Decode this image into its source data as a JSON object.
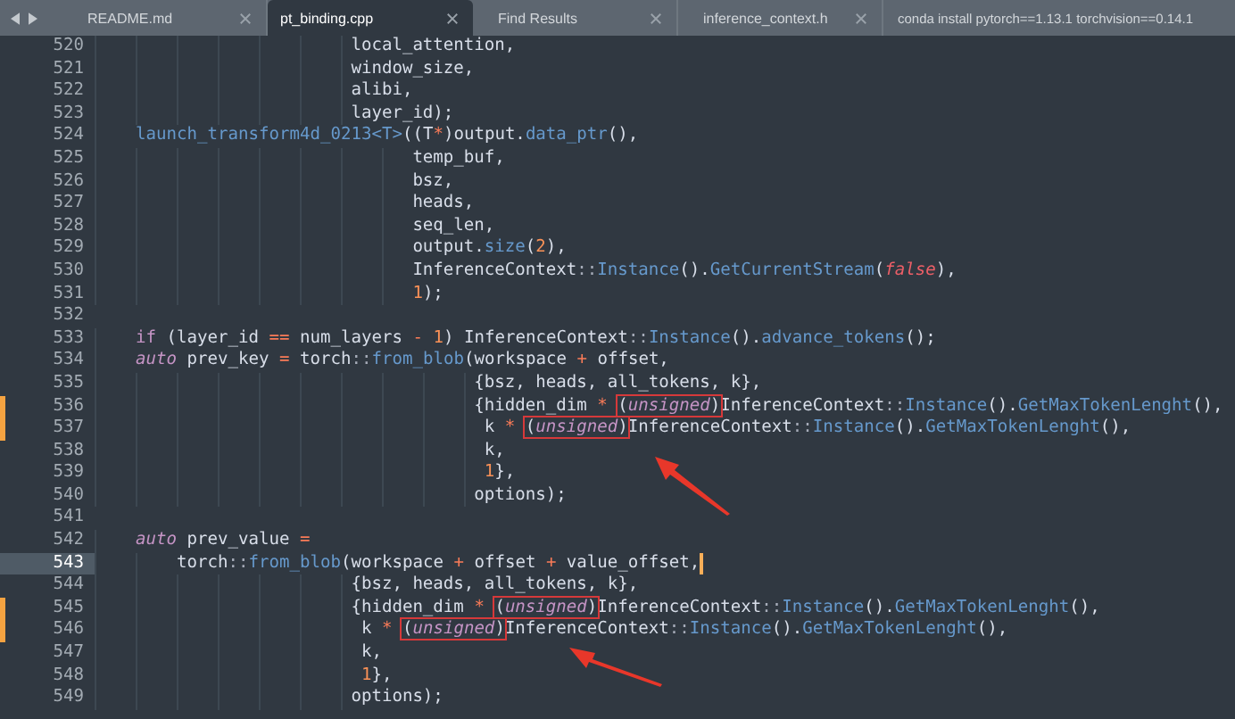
{
  "tabs": [
    {
      "label": "README.md",
      "selected": false,
      "close": true
    },
    {
      "label": "pt_binding.cpp",
      "selected": true,
      "close": true
    },
    {
      "label": "Find Results",
      "selected": false,
      "close": true
    },
    {
      "label": "inference_context.h",
      "selected": false,
      "close": true
    },
    {
      "label": "conda install pytorch==1.13.1 torchvision==0.14.1",
      "selected": false,
      "close": false
    }
  ],
  "editor": {
    "lines": [
      {
        "number": "520",
        "tokens": [
          {
            "text": "                         local_attention,",
            "kind": "plain"
          }
        ]
      },
      {
        "number": "521",
        "tokens": [
          {
            "text": "                         window_size,",
            "kind": "plain"
          }
        ]
      },
      {
        "number": "522",
        "tokens": [
          {
            "text": "                         alibi,",
            "kind": "plain"
          }
        ]
      },
      {
        "number": "523",
        "tokens": [
          {
            "text": "                         layer_id);",
            "kind": "plain"
          }
        ]
      },
      {
        "number": "524",
        "tokens": [
          {
            "text": "    launch_transform4d_0213<T>",
            "kind": "function"
          },
          {
            "text": "((T",
            "kind": "plain"
          },
          {
            "text": "*",
            "kind": "operator"
          },
          {
            "text": ")output.",
            "kind": "plain"
          },
          {
            "text": "data_ptr",
            "kind": "function"
          },
          {
            "text": "(),",
            "kind": "plain"
          }
        ]
      },
      {
        "number": "525",
        "tokens": [
          {
            "text": "                               temp_buf,",
            "kind": "plain"
          }
        ]
      },
      {
        "number": "526",
        "tokens": [
          {
            "text": "                               bsz,",
            "kind": "plain"
          }
        ]
      },
      {
        "number": "527",
        "tokens": [
          {
            "text": "                               heads,",
            "kind": "plain"
          }
        ]
      },
      {
        "number": "528",
        "tokens": [
          {
            "text": "                               seq_len,",
            "kind": "plain"
          }
        ]
      },
      {
        "number": "529",
        "tokens": [
          {
            "text": "                               output.",
            "kind": "plain"
          },
          {
            "text": "size",
            "kind": "function"
          },
          {
            "text": "(",
            "kind": "plain"
          },
          {
            "text": "2",
            "kind": "number"
          },
          {
            "text": "),",
            "kind": "plain"
          }
        ]
      },
      {
        "number": "530",
        "tokens": [
          {
            "text": "                               InferenceContext",
            "kind": "plain"
          },
          {
            "text": "::",
            "kind": "scope"
          },
          {
            "text": "Instance",
            "kind": "function"
          },
          {
            "text": "().",
            "kind": "plain"
          },
          {
            "text": "GetCurrentStream",
            "kind": "function"
          },
          {
            "text": "(",
            "kind": "plain"
          },
          {
            "text": "false",
            "kind": "constant"
          },
          {
            "text": "),",
            "kind": "plain"
          }
        ]
      },
      {
        "number": "531",
        "tokens": [
          {
            "text": "                               1",
            "kind": "number"
          },
          {
            "text": ");",
            "kind": "plain"
          }
        ]
      },
      {
        "number": "532"
      },
      {
        "number": "533",
        "tokens": [
          {
            "text": "    if",
            "kind": "keyword"
          },
          {
            "text": " (layer_id ",
            "kind": "plain"
          },
          {
            "text": "==",
            "kind": "operator"
          },
          {
            "text": " num_layers ",
            "kind": "plain"
          },
          {
            "text": "- ",
            "kind": "operator"
          },
          {
            "text": "1",
            "kind": "number"
          },
          {
            "text": ") InferenceContext",
            "kind": "plain"
          },
          {
            "text": "::",
            "kind": "scope"
          },
          {
            "text": "Instance",
            "kind": "function"
          },
          {
            "text": "().",
            "kind": "plain"
          },
          {
            "text": "advance_tokens",
            "kind": "function"
          },
          {
            "text": "();",
            "kind": "plain"
          }
        ]
      },
      {
        "number": "534",
        "tokens": [
          {
            "text": "    auto",
            "kind": "type"
          },
          {
            "text": " prev_key ",
            "kind": "plain"
          },
          {
            "text": "=",
            "kind": "operator"
          },
          {
            "text": " torch",
            "kind": "plain"
          },
          {
            "text": "::",
            "kind": "scope"
          },
          {
            "text": "from_blob",
            "kind": "function"
          },
          {
            "text": "(workspace ",
            "kind": "plain"
          },
          {
            "text": "+",
            "kind": "operator"
          },
          {
            "text": " offset,",
            "kind": "plain"
          }
        ]
      },
      {
        "number": "535",
        "tokens": [
          {
            "text": "                                     {bsz, heads, all_tokens, k},",
            "kind": "plain"
          }
        ]
      },
      {
        "number": "536",
        "modified": true,
        "tokens": [
          {
            "text": "                                     {hidden_dim ",
            "kind": "plain"
          },
          {
            "text": "* ",
            "kind": "operator"
          },
          {
            "kind": "box",
            "parts": [
              {
                "text": "(",
                "kind": "plain"
              },
              {
                "text": "unsigned",
                "kind": "type"
              },
              {
                "text": ")",
                "kind": "plain"
              }
            ]
          },
          {
            "text": "InferenceContext",
            "kind": "plain"
          },
          {
            "text": "::",
            "kind": "scope"
          },
          {
            "text": "Instance",
            "kind": "function"
          },
          {
            "text": "().",
            "kind": "plain"
          },
          {
            "text": "GetMaxTokenLenght",
            "kind": "function"
          },
          {
            "text": "(),",
            "kind": "plain"
          }
        ]
      },
      {
        "number": "537",
        "modified": true,
        "tokens": [
          {
            "text": "                                      k ",
            "kind": "plain"
          },
          {
            "text": "* ",
            "kind": "operator"
          },
          {
            "kind": "box",
            "parts": [
              {
                "text": "(",
                "kind": "plain"
              },
              {
                "text": "unsigned",
                "kind": "type"
              },
              {
                "text": ")",
                "kind": "plain"
              }
            ]
          },
          {
            "text": "InferenceContext",
            "kind": "plain"
          },
          {
            "text": "::",
            "kind": "scope"
          },
          {
            "text": "Instance",
            "kind": "function"
          },
          {
            "text": "().",
            "kind": "plain"
          },
          {
            "text": "GetMaxTokenLenght",
            "kind": "function"
          },
          {
            "text": "(),",
            "kind": "plain"
          }
        ]
      },
      {
        "number": "538",
        "arrow": true,
        "tokens": [
          {
            "text": "                                      k,",
            "kind": "plain"
          }
        ]
      },
      {
        "number": "539",
        "tokens": [
          {
            "text": "                                      1",
            "kind": "number"
          },
          {
            "text": "},",
            "kind": "plain"
          }
        ]
      },
      {
        "number": "540",
        "tokens": [
          {
            "text": "                                     options);",
            "kind": "plain"
          }
        ]
      },
      {
        "number": "541"
      },
      {
        "number": "542",
        "tokens": [
          {
            "text": "    auto",
            "kind": "type"
          },
          {
            "text": " prev_value ",
            "kind": "plain"
          },
          {
            "text": "=",
            "kind": "operator"
          }
        ]
      },
      {
        "number": "543",
        "current": true,
        "cursor": true,
        "tokens": [
          {
            "text": "        torch",
            "kind": "plain"
          },
          {
            "text": "::",
            "kind": "scope"
          },
          {
            "text": "from_blob",
            "kind": "function"
          },
          {
            "text": "(workspace ",
            "kind": "plain"
          },
          {
            "text": "+",
            "kind": "operator"
          },
          {
            "text": " offset ",
            "kind": "plain"
          },
          {
            "text": "+",
            "kind": "operator"
          },
          {
            "text": " value_offset,",
            "kind": "plain"
          }
        ]
      },
      {
        "number": "544",
        "tokens": [
          {
            "text": "                         {bsz, heads, all_tokens, k},",
            "kind": "plain"
          }
        ]
      },
      {
        "number": "545",
        "modified": true,
        "tokens": [
          {
            "text": "                         {hidden_dim ",
            "kind": "plain"
          },
          {
            "text": "* ",
            "kind": "operator"
          },
          {
            "kind": "box",
            "parts": [
              {
                "text": "(",
                "kind": "plain"
              },
              {
                "text": "unsigned",
                "kind": "type"
              },
              {
                "text": ")",
                "kind": "plain"
              }
            ]
          },
          {
            "text": "InferenceContext",
            "kind": "plain"
          },
          {
            "text": "::",
            "kind": "scope"
          },
          {
            "text": "Instance",
            "kind": "function"
          },
          {
            "text": "().",
            "kind": "plain"
          },
          {
            "text": "GetMaxTokenLenght",
            "kind": "function"
          },
          {
            "text": "(),",
            "kind": "plain"
          }
        ]
      },
      {
        "number": "546",
        "modified": true,
        "tokens": [
          {
            "text": "                          k ",
            "kind": "plain"
          },
          {
            "text": "* ",
            "kind": "operator"
          },
          {
            "kind": "box",
            "parts": [
              {
                "text": "(",
                "kind": "plain"
              },
              {
                "text": "unsigned",
                "kind": "type"
              },
              {
                "text": ")",
                "kind": "plain"
              }
            ]
          },
          {
            "text": "InferenceContext",
            "kind": "plain"
          },
          {
            "text": "::",
            "kind": "scope"
          },
          {
            "text": "Instance",
            "kind": "function"
          },
          {
            "text": "().",
            "kind": "plain"
          },
          {
            "text": "GetMaxTokenLenght",
            "kind": "function"
          },
          {
            "text": "(),",
            "kind": "plain"
          }
        ]
      },
      {
        "number": "547",
        "arrow": true,
        "tokens": [
          {
            "text": "                          k,",
            "kind": "plain"
          }
        ]
      },
      {
        "number": "548",
        "tokens": [
          {
            "text": "                          1",
            "kind": "number"
          },
          {
            "text": "},",
            "kind": "plain"
          }
        ]
      },
      {
        "number": "549",
        "tokens": [
          {
            "text": "                         options);",
            "kind": "plain"
          }
        ]
      }
    ]
  }
}
